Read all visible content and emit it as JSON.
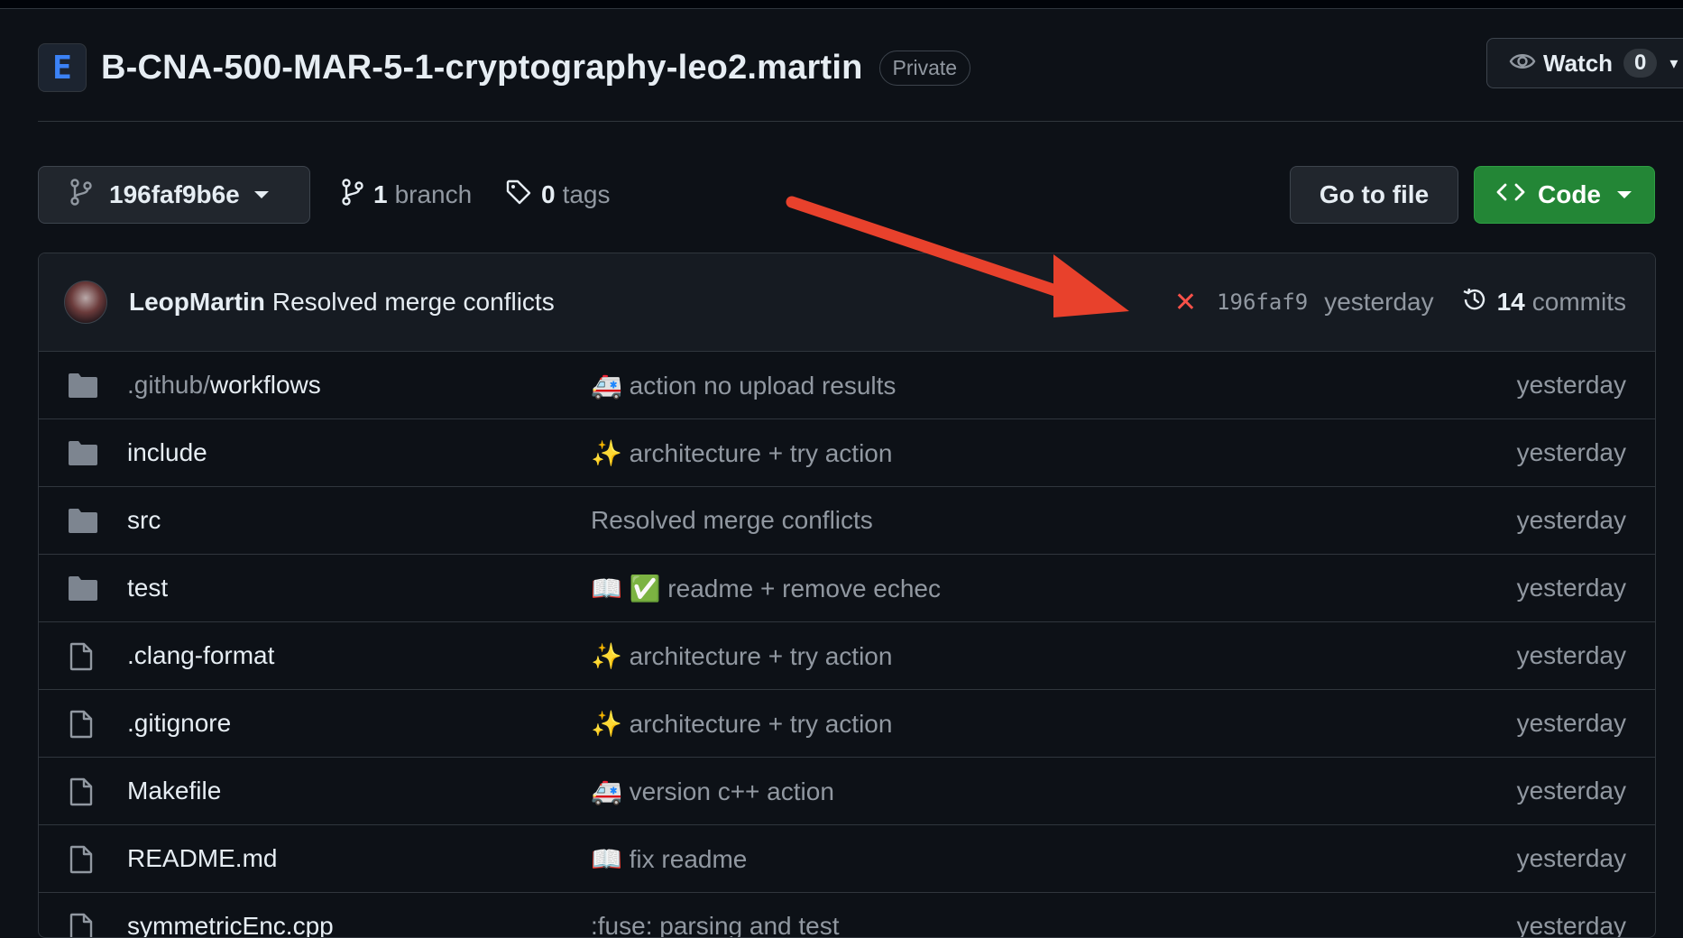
{
  "repo": {
    "logo_letter": "E",
    "name": "B-CNA-500-MAR-5-1-cryptography-leo2.martin",
    "visibility": "Private",
    "watch_label": "Watch",
    "watch_count": "0"
  },
  "toolbar": {
    "branch_name": "196faf9b6e",
    "branch_count": "1",
    "branch_label": "branch",
    "tag_count": "0",
    "tag_label": "tags",
    "goto_label": "Go to file",
    "code_label": "Code"
  },
  "latest_commit": {
    "author": "LeopMartin",
    "message": "Resolved merge conflicts",
    "status_icon": "x-icon",
    "sha": "196faf9",
    "time": "yesterday",
    "commit_count": "14",
    "commits_label": "commits"
  },
  "files": [
    {
      "type": "folder",
      "prefix": ".github/",
      "name": "workflows",
      "emoji": "🚑",
      "message": "action no upload results",
      "time": "yesterday"
    },
    {
      "type": "folder",
      "prefix": "",
      "name": "include",
      "emoji": "✨",
      "message": "architecture + try action",
      "time": "yesterday"
    },
    {
      "type": "folder",
      "prefix": "",
      "name": "src",
      "emoji": "",
      "message": "Resolved merge conflicts",
      "time": "yesterday"
    },
    {
      "type": "folder",
      "prefix": "",
      "name": "test",
      "emoji": "📖 ✅",
      "message": "readme + remove echec",
      "time": "yesterday"
    },
    {
      "type": "file",
      "prefix": "",
      "name": ".clang-format",
      "emoji": "✨",
      "message": "architecture + try action",
      "time": "yesterday"
    },
    {
      "type": "file",
      "prefix": "",
      "name": ".gitignore",
      "emoji": "✨",
      "message": "architecture + try action",
      "time": "yesterday"
    },
    {
      "type": "file",
      "prefix": "",
      "name": "Makefile",
      "emoji": "🚑",
      "message": "version c++ action",
      "time": "yesterday"
    },
    {
      "type": "file",
      "prefix": "",
      "name": "README.md",
      "emoji": "📖",
      "message": "fix readme",
      "time": "yesterday"
    },
    {
      "type": "file",
      "prefix": "",
      "name": "symmetricEnc.cpp",
      "emoji": "",
      "message": ":fuse: parsing and test",
      "time": "yesterday"
    }
  ],
  "colors": {
    "background": "#0d1117",
    "accent_green": "#238636",
    "fail_red": "#f85149",
    "annotation_arrow": "#e8412c"
  }
}
